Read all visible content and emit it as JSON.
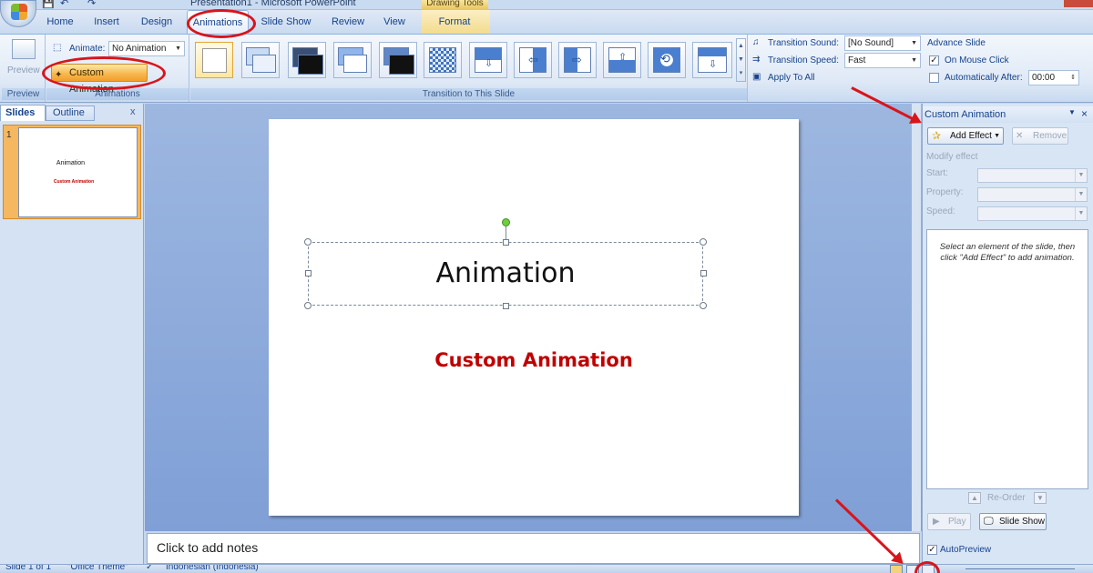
{
  "title_bar": {
    "title": "Presentation1 - Microsoft PowerPoint",
    "contextual_tab_group": "Drawing Tools",
    "qat_undo": "↶",
    "qat_redo": "↷"
  },
  "tabs": [
    {
      "label": "Home"
    },
    {
      "label": "Insert"
    },
    {
      "label": "Design"
    },
    {
      "label": "Animations",
      "active": true
    },
    {
      "label": "Slide Show"
    },
    {
      "label": "Review"
    },
    {
      "label": "View"
    },
    {
      "label": "Format"
    }
  ],
  "ribbon": {
    "preview_group": {
      "button_label": "Preview",
      "group_label": "Preview"
    },
    "animations_group": {
      "animate_label": "Animate:",
      "animate_value": "No Animation",
      "custom_animation_label": "Custom Animation",
      "group_label": "Animations"
    },
    "transition_group": {
      "group_label": "Transition to This Slide",
      "sound_label": "Transition Sound:",
      "sound_value": "[No Sound]",
      "speed_label": "Transition Speed:",
      "speed_value": "Fast",
      "apply_all_label": "Apply To All"
    },
    "advance_group": {
      "title": "Advance Slide",
      "on_mouse_click_label": "On Mouse Click",
      "on_mouse_click_checked": true,
      "auto_after_label": "Automatically After:",
      "auto_after_checked": false,
      "auto_after_value": "00:00"
    }
  },
  "left_pane": {
    "tab_slides": "Slides",
    "tab_outline": "Outline",
    "close": "x",
    "thumbnail": {
      "number": "1",
      "title": "Animation",
      "subtitle": "Custom Animation"
    }
  },
  "slide": {
    "title": "Animation",
    "subtitle": "Custom Animation"
  },
  "notes": {
    "placeholder": "Click to add notes"
  },
  "custom_animation_pane": {
    "title": "Custom Animation",
    "add_effect": "Add Effect",
    "remove": "Remove",
    "modify_effect": "Modify effect",
    "start_label": "Start:",
    "property_label": "Property:",
    "speed_label": "Speed:",
    "hint": "Select an element of the slide, then click \"Add Effect\" to add animation.",
    "reorder": "Re-Order",
    "play": "Play",
    "slide_show": "Slide Show",
    "autopreview": "AutoPreview",
    "autopreview_checked": true
  },
  "status_bar": {
    "slide_info": "Slide 1 of 1",
    "theme": "\"Office Theme\"",
    "language": "Indonesian (Indonesia)"
  },
  "colors": {
    "annotation_red": "#d8151c",
    "subtitle_red": "#c00000",
    "ribbon_blue": "#15428b"
  }
}
